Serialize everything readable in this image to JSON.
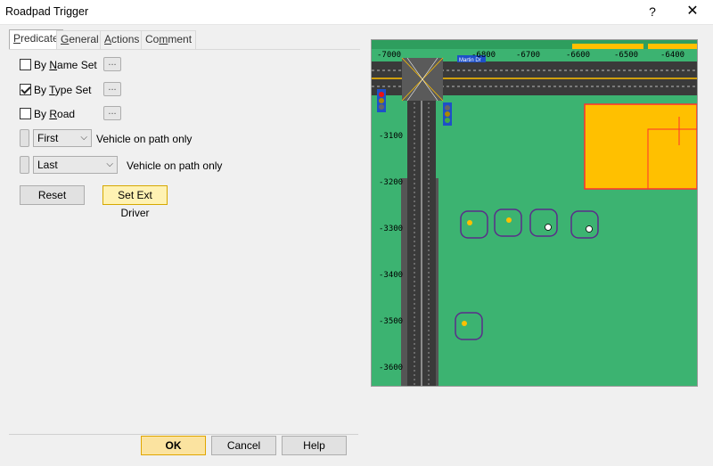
{
  "window": {
    "title": "Roadpad Trigger",
    "help_glyph": "?",
    "close_glyph": "✕"
  },
  "tabs": [
    {
      "label_pre": "",
      "label_ul": "P",
      "label_post": "redicate"
    },
    {
      "label_pre": "",
      "label_ul": "G",
      "label_post": "eneral"
    },
    {
      "label_pre": "",
      "label_ul": "A",
      "label_post": "ctions"
    },
    {
      "label_pre": "Co",
      "label_ul": "m",
      "label_post": "ment"
    }
  ],
  "predicate": {
    "by_name_set": {
      "label_pre": "By ",
      "label_ul": "N",
      "label_post": "ame Set",
      "checked": false
    },
    "by_type_set": {
      "label_pre": "By ",
      "label_ul": "T",
      "label_post": "ype Set",
      "checked": true
    },
    "by_road": {
      "label_pre": "By ",
      "label_ul": "R",
      "label_post": "oad",
      "checked": false
    },
    "dots_label": "...",
    "row1": {
      "select_value": "First",
      "text": "Vehicle on path only"
    },
    "row2": {
      "select_value": "Last",
      "text": "Vehicle on path only"
    },
    "reset_label": "Reset",
    "set_ext_driver_label": "Set Ext Driver"
  },
  "footer": {
    "ok_label": "OK",
    "cancel_label": "Cancel",
    "help_label": "Help"
  },
  "map": {
    "colors": {
      "grass": "#3cb371",
      "asphalt": "#3a3a3a",
      "building": "#ffc000",
      "building_edge": "#ff3030",
      "selection": "#5a2d8a"
    },
    "x_ticks": [
      "-7000",
      "-6800",
      "-6700",
      "-6600",
      "-6500",
      "-6400"
    ],
    "y_ticks": [
      "-3100",
      "-3200",
      "-3300",
      "-3400",
      "-3500",
      "-3600"
    ],
    "street_label": "Martin Dr"
  }
}
